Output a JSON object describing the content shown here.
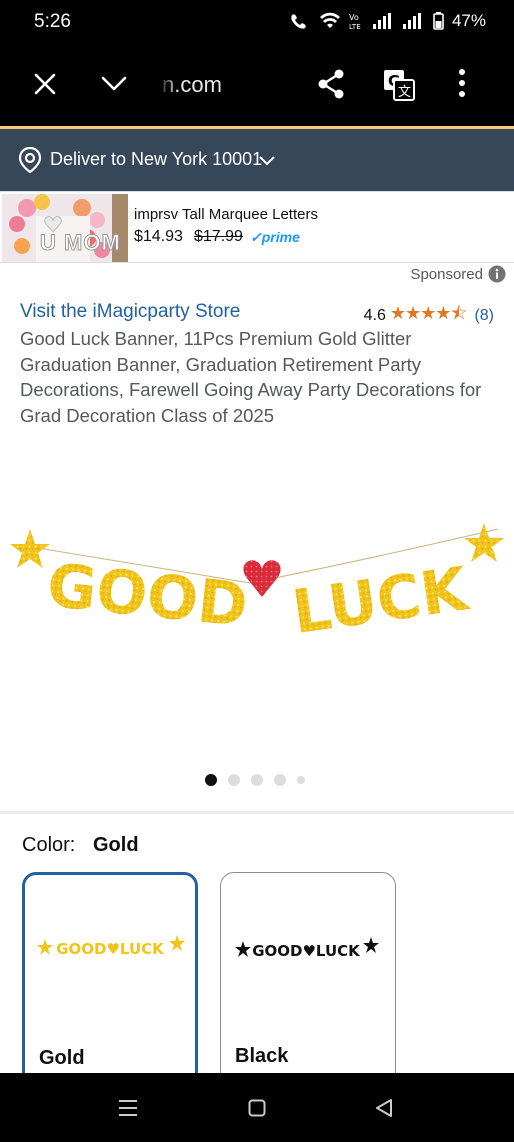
{
  "status": {
    "time": "5:26",
    "battery": "47%"
  },
  "browser": {
    "url": "n.com"
  },
  "deliver": {
    "text": "Deliver to New York 10001"
  },
  "ad": {
    "image_text": "U MOM",
    "title": "imprsv Tall Marquee Letters",
    "price": "$14.93",
    "list_price": "$17.99",
    "prime": "✓prime"
  },
  "sponsored": "Sponsored",
  "product": {
    "store_link": "Visit the iMagicparty Store",
    "rating": "4.6",
    "stars": "★★★★⯪",
    "review_count": "(8)",
    "title": "Good Luck Banner, 11Pcs Premium Gold Glitter Graduation Banner, Graduation Retirement Party Decorations, Farewell Going Away Party Decorations for Grad Decoration Class of 2025",
    "banner_left": "GOOD",
    "banner_right": "LUCK",
    "image_count": 5,
    "active_image_index": 0
  },
  "color": {
    "label": "Color:",
    "selected": "Gold",
    "options": [
      {
        "name": "Gold",
        "banner_text": "GOOD♥LUCK",
        "selected": true
      },
      {
        "name": "Black",
        "banner_text": "GOOD♥LUCK",
        "selected": false
      }
    ]
  },
  "colors": {
    "status_bg": "#000000",
    "deliver_bg": "#37475a",
    "link": "#2162a1",
    "star": "#de7921",
    "prime": "#1a98ff",
    "gold": "#f0c419",
    "heart": "#d92b3a",
    "selected_border": "#2162a1"
  },
  "icons": {
    "close": "close-icon",
    "chevron": "chevron-down-icon",
    "share": "share-icon",
    "translate": "translate-icon",
    "more": "more-vertical-icon",
    "location": "location-pin-icon",
    "info": "info-icon",
    "nav_menu": "recent-apps-icon",
    "nav_home": "home-icon",
    "nav_back": "back-icon"
  }
}
